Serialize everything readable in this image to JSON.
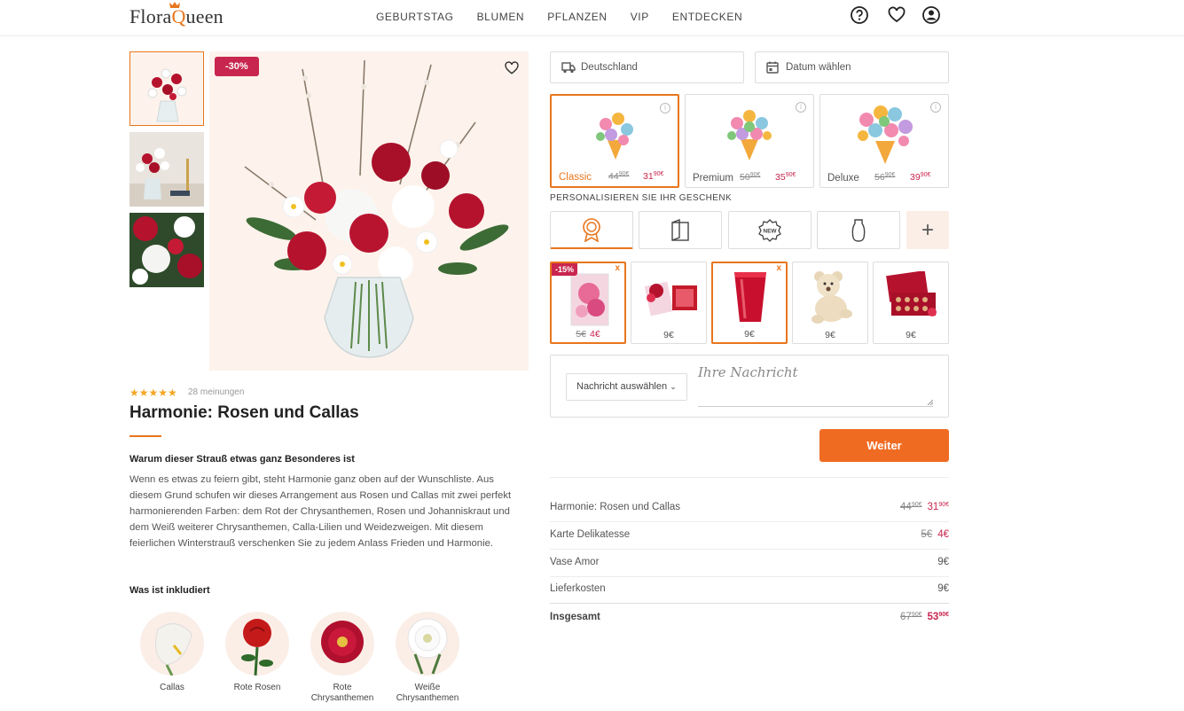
{
  "header": {
    "logo_pre": "Flora",
    "logo_q": "Q",
    "logo_post": "ueen",
    "nav": [
      "GEBURTSTAG",
      "BLUMEN",
      "PFLANZEN",
      "VIP",
      "ENTDECKEN"
    ],
    "icons": [
      "help-icon",
      "heart-icon",
      "user-icon"
    ]
  },
  "gallery": {
    "discount_badge": "-30%"
  },
  "product": {
    "stars": "★★★★★",
    "reviews": "28 meinungen",
    "title": "Harmonie: Rosen und Callas",
    "why_heading": "Warum dieser Strauß etwas ganz Besonderes ist",
    "description": "Wenn es etwas zu feiern gibt, steht Harmonie ganz oben auf der Wunschliste. Aus diesem Grund schufen wir dieses Arrangement aus Rosen und Callas mit zwei perfekt harmonierenden Farben: dem Rot der Chrysanthemen, Rosen und Johanniskraut und dem Weiß weiterer Chrysanthemen, Calla-Lilien und Weidezweigen. Mit diesem feierlichen Winterstrauß verschenken Sie zu jedem Anlass Frieden und Harmonie.",
    "included_heading": "Was ist inkludiert",
    "included": [
      {
        "line1": "Callas",
        "line2": ""
      },
      {
        "line1": "Rote Rosen",
        "line2": ""
      },
      {
        "line1": "Rote",
        "line2": "Chrysanthemen"
      },
      {
        "line1": "Weiße",
        "line2": "Chrysanthemen"
      }
    ]
  },
  "delivery": {
    "country": "Deutschland",
    "date_placeholder": "Datum wählen"
  },
  "variants": [
    {
      "name": "Classic",
      "old": "44",
      "old_cents": "90€",
      "new": "31",
      "new_cents": "90€"
    },
    {
      "name": "Premium",
      "old": "50",
      "old_cents": "90€",
      "new": "35",
      "new_cents": "90€"
    },
    {
      "name": "Deluxe",
      "old": "56",
      "old_cents": "90€",
      "new": "39",
      "new_cents": "90€"
    }
  ],
  "personalize": {
    "title": "PERSONALISIEREN SIE IHR GESCHENK",
    "tabs": [
      "award-icon",
      "card-icon",
      "new-badge-icon",
      "vase-icon"
    ],
    "plus": "+",
    "new_badge_text": "NEW"
  },
  "gifts": [
    {
      "old": "5€",
      "price": "4€",
      "badge": "-15%",
      "remove": "x"
    },
    {
      "old": "",
      "price": "9€",
      "badge": "",
      "remove": ""
    },
    {
      "old": "",
      "price": "9€",
      "badge": "",
      "remove": "x"
    },
    {
      "old": "",
      "price": "9€",
      "badge": "",
      "remove": ""
    },
    {
      "old": "",
      "price": "9€",
      "badge": "",
      "remove": ""
    }
  ],
  "message": {
    "select_label": "Nachricht auswählen",
    "placeholder": "Ihre Nachricht"
  },
  "cta": "Weiter",
  "summary": [
    {
      "label": "Harmonie: Rosen und Callas",
      "old": "44",
      "old_cents": "90€",
      "new": "31",
      "new_cents": "90€"
    },
    {
      "label": "Karte Delikatesse",
      "old": "5€",
      "old_cents": "",
      "new": "4€",
      "new_cents": ""
    },
    {
      "label": "Vase Amor",
      "old": "",
      "old_cents": "",
      "new": "9€",
      "new_cents": ""
    },
    {
      "label": "Lieferkosten",
      "old": "",
      "old_cents": "",
      "new": "9€",
      "new_cents": ""
    }
  ],
  "total": {
    "label": "Insgesamt",
    "old": "67",
    "old_cents": "90€",
    "new": "53",
    "new_cents": "90€"
  },
  "colors": {
    "accent": "#e8761e",
    "sale": "#c8264e",
    "cta": "#f06b22"
  }
}
